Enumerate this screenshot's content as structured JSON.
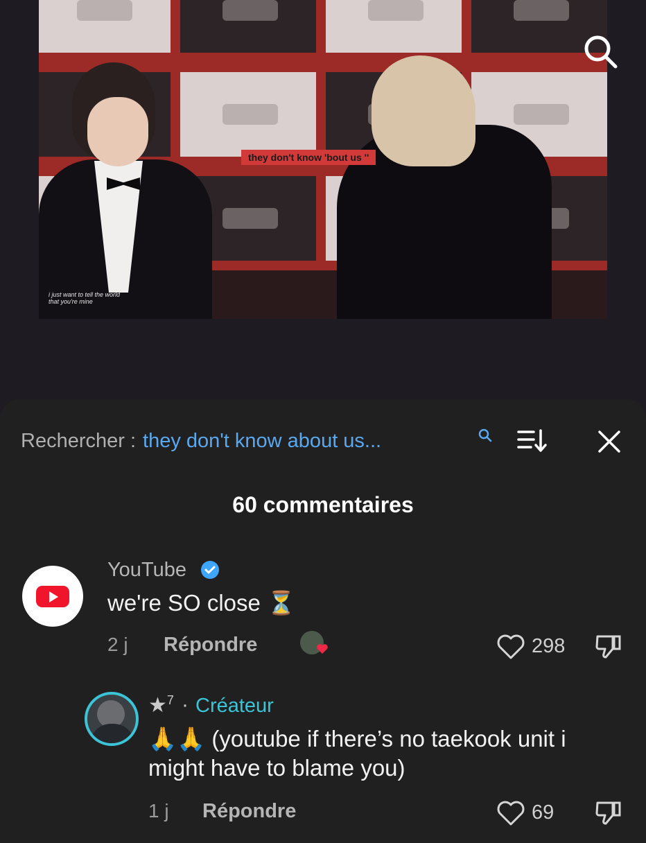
{
  "video": {
    "caption": "they don't know 'bout us ''",
    "subtitle_line1": "i just want to tell the world",
    "subtitle_line2": "that you're mine"
  },
  "comments_panel": {
    "search_label": "Rechercher :",
    "search_query": "they don't know about us...",
    "count_title": "60 commentaires",
    "comments": [
      {
        "author": "YouTube",
        "verified": true,
        "text": "we're SO close ⏳",
        "time": "2 j",
        "reply_label": "Répondre",
        "likes": "298",
        "avatar_icon": "youtube-logo-icon"
      },
      {
        "author": "★",
        "author_sup": "7",
        "separator": "·",
        "badge": "Créateur",
        "text_line1": "🙏🙏 (youtube if there’s no taekook unit i",
        "text_line2": "might have to blame you)",
        "time": "1 j",
        "reply_label": "Répondre",
        "likes": "69"
      }
    ]
  },
  "colors": {
    "sheet_background": "#202020",
    "page_background": "#1e1b22",
    "query_blue": "#5aa9f0",
    "creator_teal": "#3cc4d6",
    "youtube_red": "#f1152b"
  }
}
